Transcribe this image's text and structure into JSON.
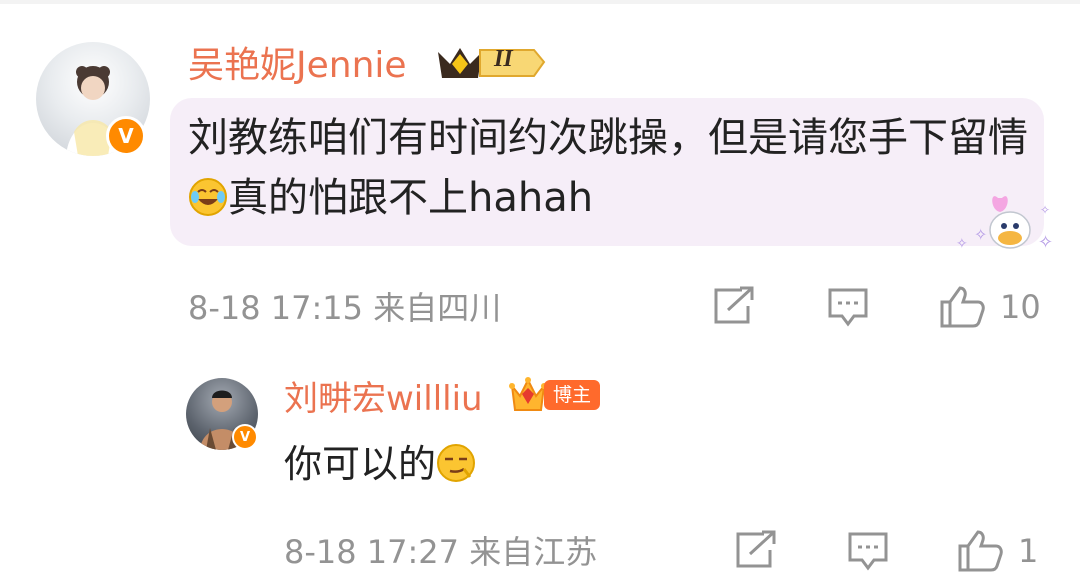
{
  "comments": [
    {
      "username": "吴艳妮Jennie",
      "content_text": "刘教练咱们有时间约次跳操，但是请您手下留情",
      "content_after": "真的怕跟不上hahah",
      "emoji": "laugh-cry-emoji",
      "meta": "8-18 17:15 来自四川",
      "likes": "10",
      "badge": {
        "type": "crown-level",
        "level_text": "II"
      },
      "bubble_color": "#f6eef8"
    },
    {
      "username": "刘畊宏willliu",
      "content_text": "你可以的",
      "emoji": "smug-emoji",
      "meta": "8-18 17:27 来自江苏",
      "likes": "1",
      "badge": {
        "type": "blogger",
        "label": "博主"
      }
    }
  ],
  "colors": {
    "username": "#eb7350",
    "meta": "#939393",
    "verified": "#ff8a00",
    "blogger_badge": "#ff6a2c"
  },
  "icons": {
    "verified_badge": "V",
    "share": "share-icon",
    "comment": "comment-icon",
    "like": "thumbs-up-icon"
  }
}
